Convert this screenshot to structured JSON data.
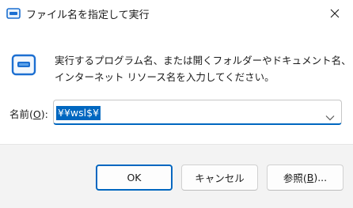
{
  "window": {
    "title": "ファイル名を指定して実行"
  },
  "dialog": {
    "description_line1": "実行するプログラム名、または開くフォルダーやドキュメント名、",
    "description_line2": "インターネット リソース名を入力してください。",
    "open_label": "名前(",
    "open_label_accesskey": "O",
    "open_label_suffix": "):",
    "open_value": "¥¥wsl$¥"
  },
  "buttons": {
    "ok": "OK",
    "cancel": "キャンセル",
    "browse_prefix": "参照(",
    "browse_accesskey": "B",
    "browse_suffix": ")..."
  },
  "colors": {
    "accent": "#0067c0",
    "footer_bg": "#f3f3f3"
  },
  "icons": {
    "title": "run-dialog-icon",
    "close": "close-icon",
    "main": "run-dialog-icon",
    "dropdown": "chevron-down-icon"
  }
}
